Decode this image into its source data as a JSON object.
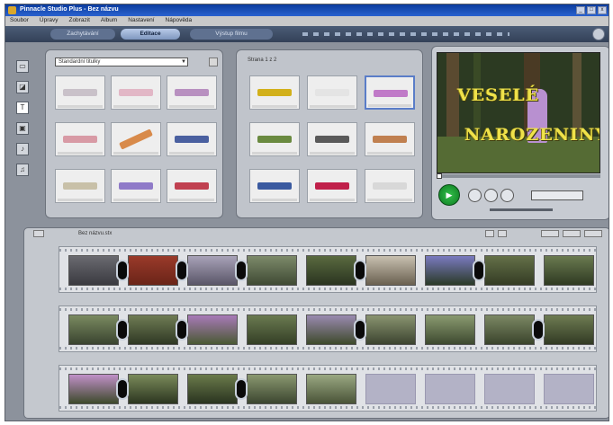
{
  "window": {
    "title": "Pinnacle Studio Plus - Bez názvu",
    "controls": [
      "_",
      "□",
      "x"
    ]
  },
  "menu": [
    "Soubor",
    "Úpravy",
    "Zobrazit",
    "Album",
    "Nastavení",
    "Nápověda"
  ],
  "modes": [
    "Zachytávání",
    "Editace",
    "Výstup filmu"
  ],
  "active_mode": "Editace",
  "left_tools": [
    {
      "icon": "video-icon",
      "glyph": "▭"
    },
    {
      "icon": "transition-icon",
      "glyph": "◪"
    },
    {
      "icon": "title-icon",
      "glyph": "T"
    },
    {
      "icon": "photo-icon",
      "glyph": "▣"
    },
    {
      "icon": "sound-icon",
      "glyph": "♪"
    },
    {
      "icon": "music-icon",
      "glyph": "♫"
    }
  ],
  "album_left": {
    "dropdown_value": "Standardní titulky"
  },
  "album_right": {
    "label": "Strana 1 z 2"
  },
  "preview": {
    "line1": "VESELÉ",
    "line2": "NAROZENINY",
    "play_label": "▶",
    "timecode": ""
  },
  "timeline": {
    "title": "Bez názvu.stx",
    "empty_slots_row3": 4
  },
  "colors": {
    "accent_blue": "#2a62cf",
    "play_green": "#1a9a30",
    "preview_text": "#efe24a"
  }
}
